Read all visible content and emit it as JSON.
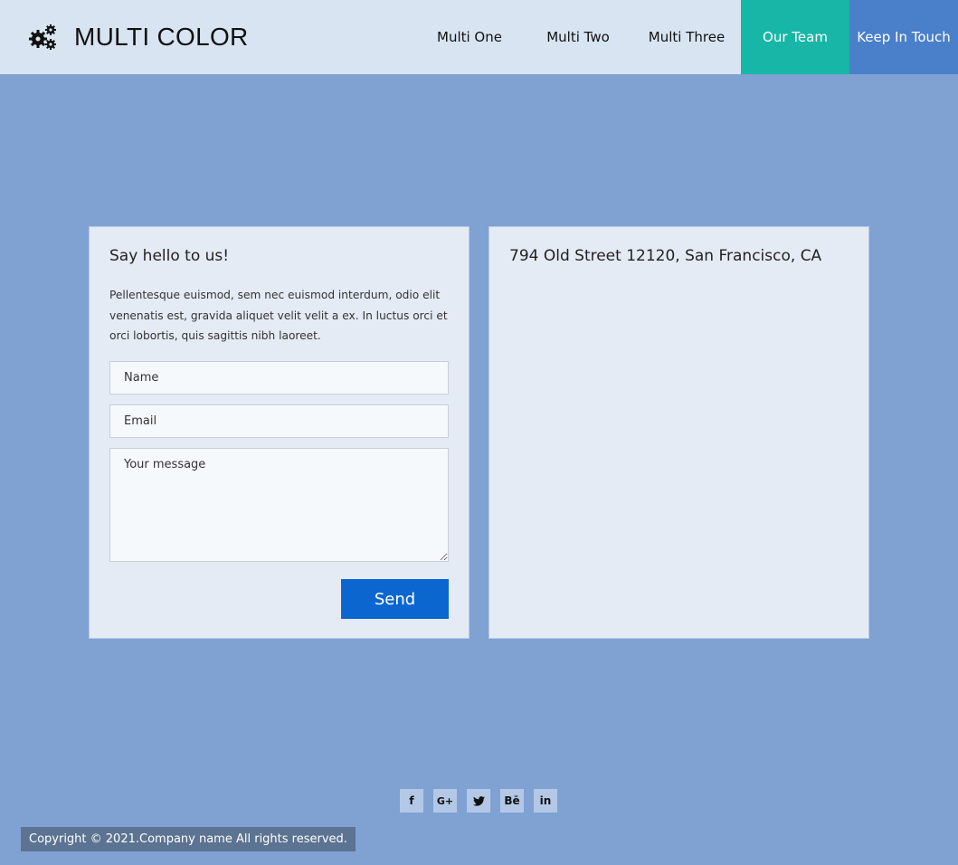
{
  "brand": {
    "title": "MULTI COLOR",
    "icon": "gears-icon"
  },
  "nav": {
    "items": [
      {
        "label": "Multi One"
      },
      {
        "label": "Multi Two"
      },
      {
        "label": "Multi Three"
      },
      {
        "label": "Our Team",
        "color": "#18b6a6"
      },
      {
        "label": "Keep In Touch",
        "color": "#4a7fc9"
      }
    ]
  },
  "contact": {
    "title": "Say hello to us!",
    "text": "Pellentesque euismod, sem nec euismod interdum, odio elit venenatis est, gravida aliquet velit velit a ex. In luctus orci et orci lobortis, quis sagittis nibh laoreet.",
    "name_placeholder": "Name",
    "email_placeholder": "Email",
    "message_placeholder": "Your message",
    "send_label": "Send"
  },
  "address": {
    "text": "794 Old Street 12120, San Francisco, CA"
  },
  "social": {
    "items": [
      {
        "label": "f",
        "icon": "facebook-icon"
      },
      {
        "label": "G+",
        "icon": "google-plus-icon"
      },
      {
        "label": "🐦",
        "icon": "twitter-icon"
      },
      {
        "label": "Bē",
        "icon": "behance-icon"
      },
      {
        "label": "in",
        "icon": "linkedin-icon"
      }
    ]
  },
  "footer": {
    "copyright": "Copyright © 2021.Company name All rights reserved."
  },
  "colors": {
    "background": "#7fa2d3",
    "header": "#d8e4f1",
    "accent_teal": "#18b6a6",
    "accent_blue": "#4a7fc9",
    "button": "#0b67cf"
  }
}
